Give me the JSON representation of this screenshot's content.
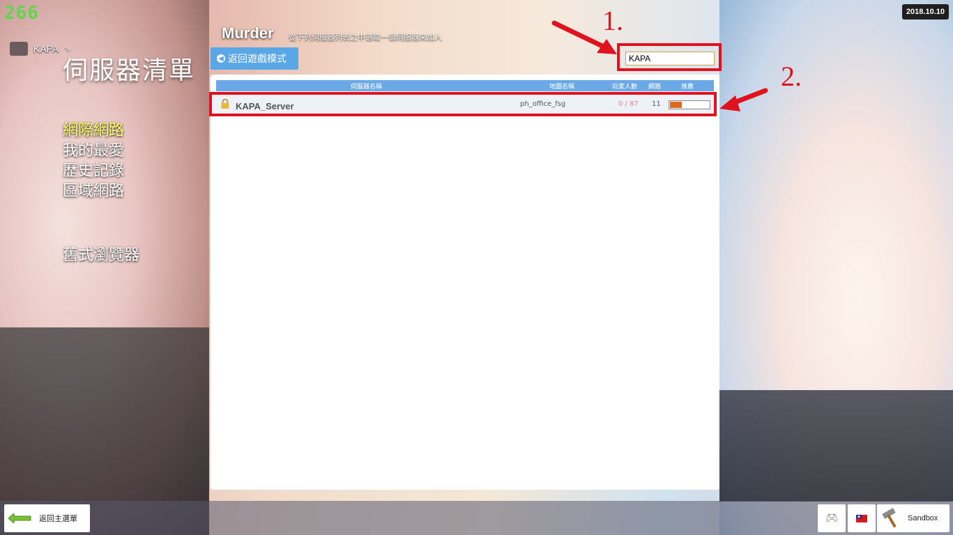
{
  "app": {
    "logo": "266",
    "date": "2018.10.10"
  },
  "user": {
    "name": "KAPA"
  },
  "page": {
    "title": "伺服器清單"
  },
  "side_nav": {
    "items": [
      {
        "label": "網際網路",
        "active": true
      },
      {
        "label": "我的最愛"
      },
      {
        "label": "歷史記錄"
      },
      {
        "label": "區域網路"
      }
    ],
    "legacy": "舊式瀏覽器"
  },
  "header": {
    "game": "Murder",
    "subtitle": "從下列伺服器列表之中選取一個伺服器來加入",
    "back_label": "返回遊戲模式"
  },
  "search": {
    "value": "KAPA"
  },
  "annotations": {
    "step1": "1.",
    "step2": "2."
  },
  "table": {
    "columns": {
      "name": "伺服器名稱",
      "map": "地圖名稱",
      "players": "玩家人數",
      "ping": "網路",
      "recommend": "推薦"
    },
    "rows": [
      {
        "name": "KAPA_Server",
        "map": "ph_office_fsg",
        "players": "0 / 87",
        "ping": "11",
        "recommend": 0.3
      }
    ]
  },
  "footer": {
    "back_main": "返回主選單",
    "sandbox": "Sandbox"
  },
  "colors": {
    "accent": "#5aa7e8",
    "annotation": "#e0121d",
    "active_nav": "#ffff66",
    "logo": "#5fd64c"
  }
}
